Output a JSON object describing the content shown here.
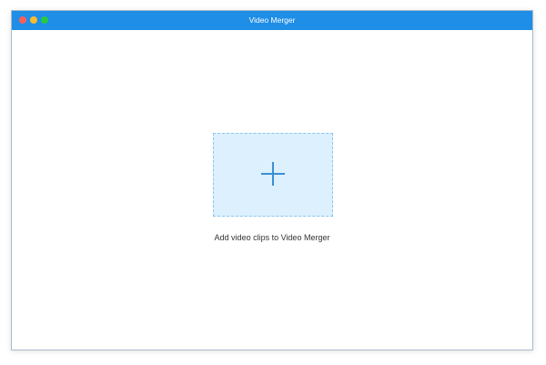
{
  "window": {
    "title": "Video Merger"
  },
  "main": {
    "add_prompt": "Add video clips to Video Merger",
    "dropzone_icon": "plus-icon"
  },
  "colors": {
    "titlebar": "#1e8ee7",
    "dropzone_fill": "#dcf0fd",
    "dropzone_border": "#8cc6ec",
    "accent": "#3b8fd6"
  }
}
